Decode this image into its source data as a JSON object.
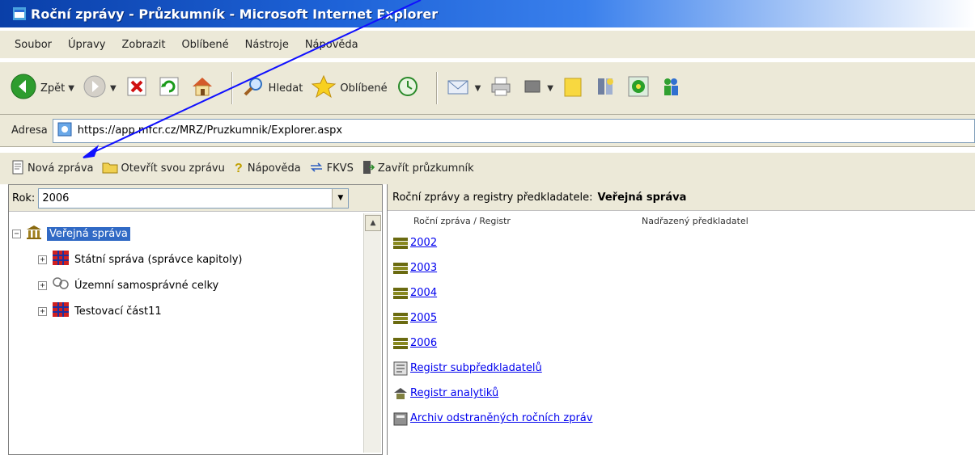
{
  "window": {
    "title": "Roční zprávy - Průzkumník - Microsoft Internet Explorer"
  },
  "menu": [
    "Soubor",
    "Úpravy",
    "Zobrazit",
    "Oblíbené",
    "Nástroje",
    "Nápověda"
  ],
  "toolbar": {
    "back_label": "Zpět",
    "search_label": "Hledat",
    "favorites_label": "Oblíbené"
  },
  "address": {
    "label": "Adresa",
    "url": "https://app.mfcr.cz/MRZ/Pruzkumnik/Explorer.aspx"
  },
  "app_toolbar": {
    "new_report": "Nová zpráva",
    "open_report": "Otevřít svou zprávu",
    "help": "Nápověda",
    "fkvs": "FKVS",
    "close_explorer": "Zavřít průzkumník"
  },
  "left": {
    "year_label": "Rok:",
    "year_value": "2006",
    "tree": {
      "root": "Veřejná správa",
      "children": [
        "Státní správa (správce kapitoly)",
        "Územní samosprávné celky",
        "Testovací část11"
      ]
    }
  },
  "right": {
    "header_label": "Roční zprávy a registry předkladatele:",
    "header_value": "Veřejná správa",
    "col_report": "Roční zpráva / Registr",
    "col_parent": "Nadřazený předkladatel",
    "items": [
      "2002",
      "2003",
      "2004",
      "2005",
      "2006",
      "Registr subpředkladatelů",
      "Registr analytiků",
      "Archiv odstraněných ročních zpráv"
    ]
  },
  "colors": {
    "title_bar": "#0a3fa8",
    "link": "#0000ee",
    "selection": "#316ac5",
    "annotation_arrow": "#0000ff"
  }
}
